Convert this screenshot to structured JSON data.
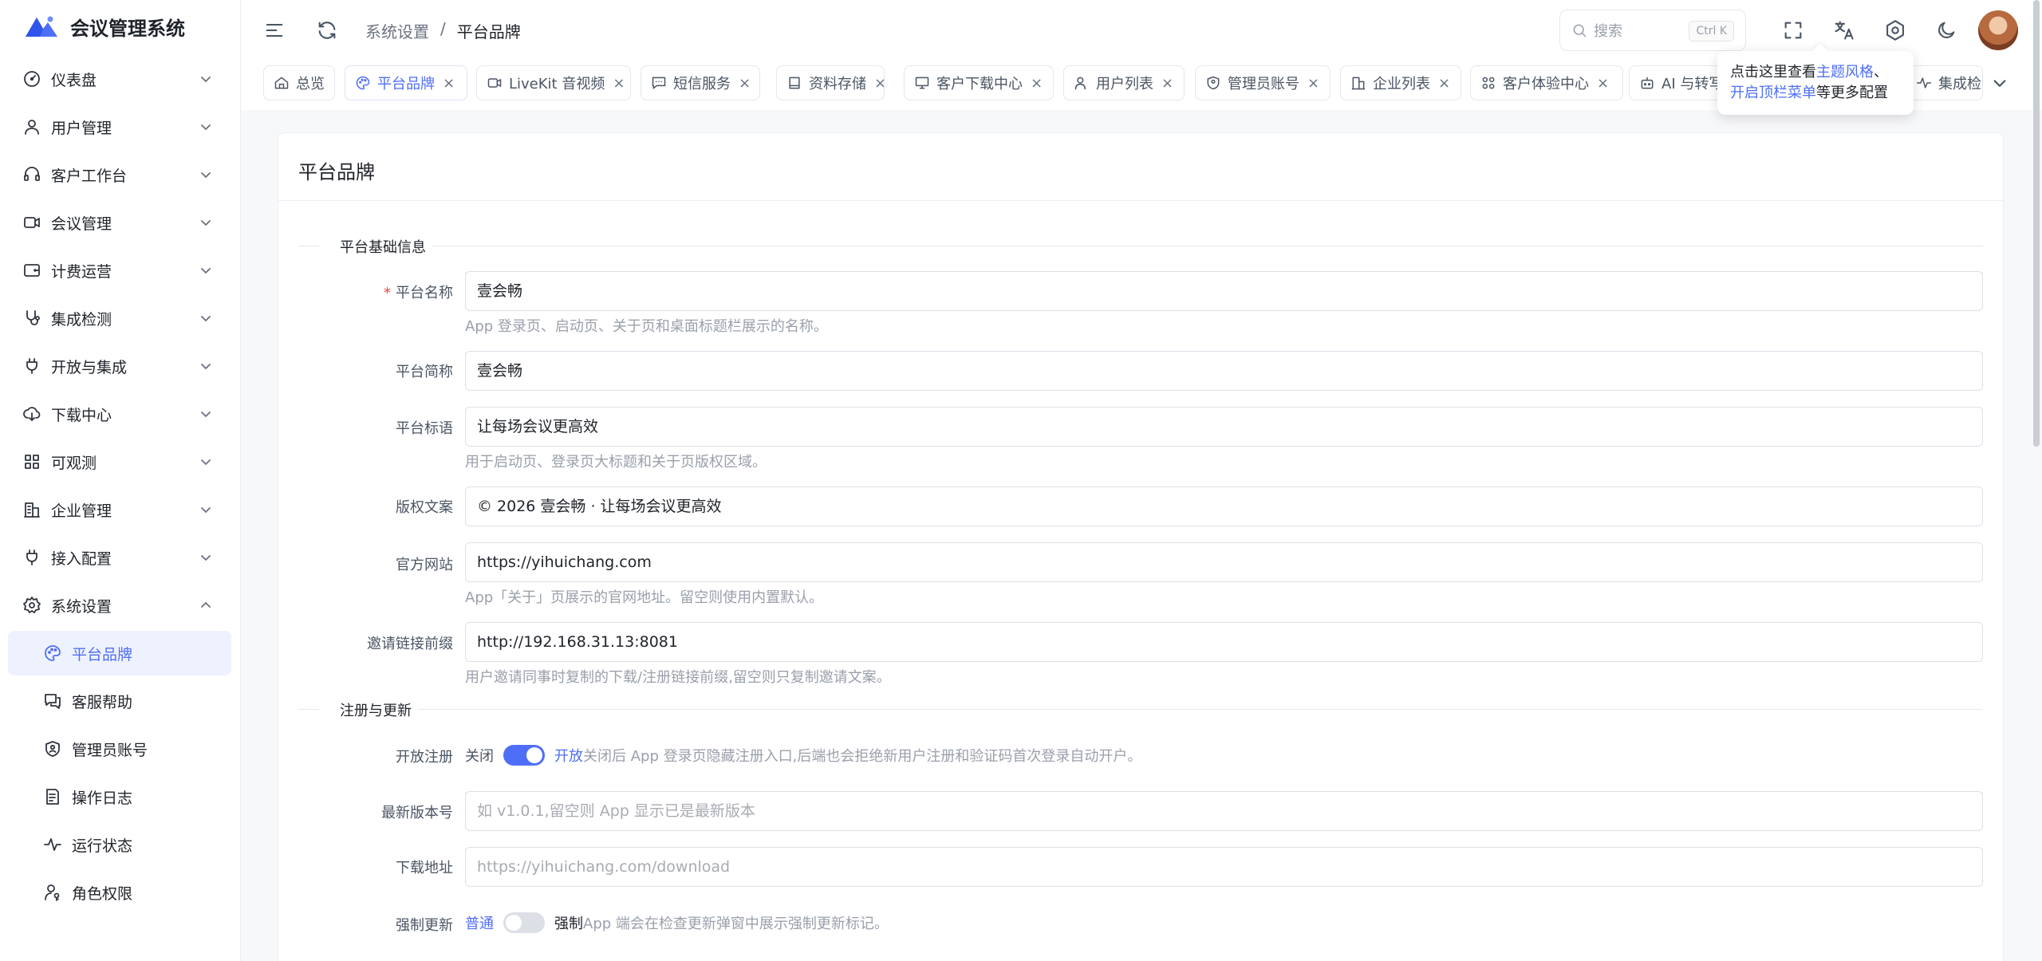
{
  "app": {
    "title": "会议管理系统"
  },
  "sidebar": {
    "items": [
      {
        "label": "仪表盘",
        "icon": "gauge-icon"
      },
      {
        "label": "用户管理",
        "icon": "user-icon"
      },
      {
        "label": "客户工作台",
        "icon": "headset-icon"
      },
      {
        "label": "会议管理",
        "icon": "video-icon"
      },
      {
        "label": "计费运营",
        "icon": "wallet-icon"
      },
      {
        "label": "集成检测",
        "icon": "stethoscope-icon"
      },
      {
        "label": "开放与集成",
        "icon": "plug-icon"
      },
      {
        "label": "下载中心",
        "icon": "cloud-download-icon"
      },
      {
        "label": "可观测",
        "icon": "grid-icon"
      },
      {
        "label": "企业管理",
        "icon": "building-icon"
      },
      {
        "label": "接入配置",
        "icon": "plug-icon"
      },
      {
        "label": "系统设置",
        "icon": "gear-icon"
      }
    ],
    "sub_items": [
      {
        "label": "平台品牌",
        "icon": "palette-icon"
      },
      {
        "label": "客服帮助",
        "icon": "chat-icon"
      },
      {
        "label": "管理员账号",
        "icon": "shield-icon"
      },
      {
        "label": "操作日志",
        "icon": "log-icon"
      },
      {
        "label": "运行状态",
        "icon": "pulse-icon"
      },
      {
        "label": "角色权限",
        "icon": "user-key-icon"
      }
    ]
  },
  "header": {
    "breadcrumb": [
      "系统设置",
      "/",
      "平台品牌"
    ],
    "search_placeholder": "搜索",
    "search_shortcut": "Ctrl K"
  },
  "tabs": [
    {
      "label": "总览",
      "closable": false
    },
    {
      "label": "平台品牌",
      "closable": true
    },
    {
      "label": "LiveKit 音视频",
      "closable": true
    },
    {
      "label": "短信服务",
      "closable": true
    },
    {
      "label": "资料存储",
      "closable": true
    },
    {
      "label": "客户下载中心",
      "closable": true
    },
    {
      "label": "用户列表",
      "closable": true
    },
    {
      "label": "管理员账号",
      "closable": true
    },
    {
      "label": "企业列表",
      "closable": true
    },
    {
      "label": "客户体验中心",
      "closable": true
    },
    {
      "label": "AI 与转写",
      "closable": false
    },
    {
      "label": "集成检测",
      "closable": false
    }
  ],
  "tooltip": {
    "prefix": "点击这里查看",
    "link1": "主题风格",
    "sep": "、",
    "link2": "开启顶栏菜单",
    "suffix": "等更多配置"
  },
  "page": {
    "title": "平台品牌",
    "section_basic": "平台基础信息",
    "section_register": "注册与更新",
    "fields": {
      "name": {
        "label": "平台名称",
        "value": "壹会畅",
        "hint": "App 登录页、启动页、关于页和桌面标题栏展示的名称。"
      },
      "short_name": {
        "label": "平台简称",
        "value": "壹会畅"
      },
      "slogan": {
        "label": "平台标语",
        "value": "让每场会议更高效",
        "hint": "用于启动页、登录页大标题和关于页版权区域。"
      },
      "copyright": {
        "label": "版权文案",
        "value": "© 2026 壹会畅 · 让每场会议更高效"
      },
      "website": {
        "label": "官方网站",
        "value": "https://yihuichang.com",
        "hint": "App「关于」页展示的官网地址。留空则使用内置默认。"
      },
      "invite_prefix": {
        "label": "邀请链接前缀",
        "value": "http://192.168.31.13:8081",
        "hint": "用户邀请同事时复制的下载/注册链接前缀,留空则只复制邀请文案。"
      },
      "open_register": {
        "label": "开放注册",
        "off_label": "关闭",
        "on_label": "开放",
        "on": true,
        "hint": "关闭后 App 登录页隐藏注册入口,后端也会拒绝新用户注册和验证码首次登录自动开户。"
      },
      "latest_version": {
        "label": "最新版本号",
        "placeholder": "如 v1.0.1,留空则 App 显示已是最新版本"
      },
      "download_url": {
        "label": "下载地址",
        "placeholder": "https://yihuichang.com/download"
      },
      "force_update": {
        "label": "强制更新",
        "off_label": "普通",
        "on_label": "强制",
        "on": false,
        "hint": "App 端会在检查更新弹窗中展示强制更新标记。"
      }
    }
  },
  "colors": {
    "accent": "#4f6ef7",
    "required": "#f04438"
  }
}
